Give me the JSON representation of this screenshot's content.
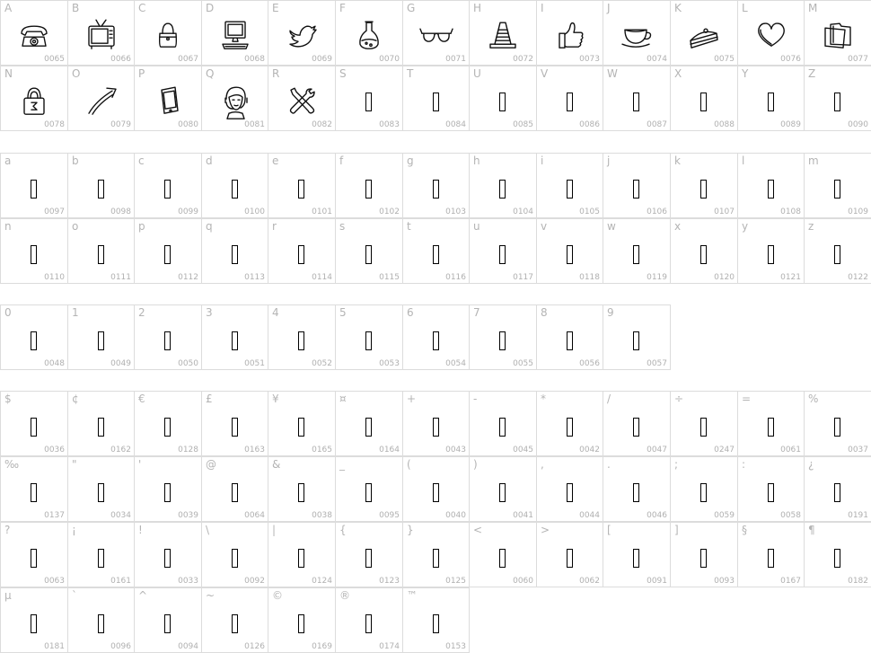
{
  "groups": [
    {
      "name": "uppercase",
      "cells": [
        {
          "label": "A",
          "code": "0065",
          "icon": "telephone-icon"
        },
        {
          "label": "B",
          "code": "0066",
          "icon": "television-icon"
        },
        {
          "label": "C",
          "code": "0067",
          "icon": "handbag-icon"
        },
        {
          "label": "D",
          "code": "0068",
          "icon": "computer-icon"
        },
        {
          "label": "E",
          "code": "0069",
          "icon": "twitter-bird-icon"
        },
        {
          "label": "F",
          "code": "0070",
          "icon": "potion-flask-icon"
        },
        {
          "label": "G",
          "code": "0071",
          "icon": "3d-glasses-icon"
        },
        {
          "label": "H",
          "code": "0072",
          "icon": "traffic-cone-icon"
        },
        {
          "label": "I",
          "code": "0073",
          "icon": "thumbs-up-icon"
        },
        {
          "label": "J",
          "code": "0074",
          "icon": "tea-cup-icon"
        },
        {
          "label": "K",
          "code": "0075",
          "icon": "cake-slice-icon"
        },
        {
          "label": "L",
          "code": "0076",
          "icon": "heart-icon"
        },
        {
          "label": "M",
          "code": "0077",
          "icon": "folders-icon"
        },
        {
          "label": "N",
          "code": "0078",
          "icon": "padlock-icon"
        },
        {
          "label": "O",
          "code": "0079",
          "icon": "arrow-icon"
        },
        {
          "label": "P",
          "code": "0080",
          "icon": "smartphone-icon"
        },
        {
          "label": "Q",
          "code": "0081",
          "icon": "headset-woman-icon"
        },
        {
          "label": "R",
          "code": "0082",
          "icon": "tools-icon"
        },
        {
          "label": "S",
          "code": "0083",
          "icon": "missing-glyph"
        },
        {
          "label": "T",
          "code": "0084",
          "icon": "missing-glyph"
        },
        {
          "label": "U",
          "code": "0085",
          "icon": "missing-glyph"
        },
        {
          "label": "V",
          "code": "0086",
          "icon": "missing-glyph"
        },
        {
          "label": "W",
          "code": "0087",
          "icon": "missing-glyph"
        },
        {
          "label": "X",
          "code": "0088",
          "icon": "missing-glyph"
        },
        {
          "label": "Y",
          "code": "0089",
          "icon": "missing-glyph"
        },
        {
          "label": "Z",
          "code": "0090",
          "icon": "missing-glyph"
        }
      ]
    },
    {
      "name": "lowercase",
      "cells": [
        {
          "label": "a",
          "code": "0097",
          "icon": "missing-glyph"
        },
        {
          "label": "b",
          "code": "0098",
          "icon": "missing-glyph"
        },
        {
          "label": "c",
          "code": "0099",
          "icon": "missing-glyph"
        },
        {
          "label": "d",
          "code": "0100",
          "icon": "missing-glyph"
        },
        {
          "label": "e",
          "code": "0101",
          "icon": "missing-glyph"
        },
        {
          "label": "f",
          "code": "0102",
          "icon": "missing-glyph"
        },
        {
          "label": "g",
          "code": "0103",
          "icon": "missing-glyph"
        },
        {
          "label": "h",
          "code": "0104",
          "icon": "missing-glyph"
        },
        {
          "label": "i",
          "code": "0105",
          "icon": "missing-glyph"
        },
        {
          "label": "j",
          "code": "0106",
          "icon": "missing-glyph"
        },
        {
          "label": "k",
          "code": "0107",
          "icon": "missing-glyph"
        },
        {
          "label": "l",
          "code": "0108",
          "icon": "missing-glyph"
        },
        {
          "label": "m",
          "code": "0109",
          "icon": "missing-glyph"
        },
        {
          "label": "n",
          "code": "0110",
          "icon": "missing-glyph"
        },
        {
          "label": "o",
          "code": "0111",
          "icon": "missing-glyph"
        },
        {
          "label": "p",
          "code": "0112",
          "icon": "missing-glyph"
        },
        {
          "label": "q",
          "code": "0113",
          "icon": "missing-glyph"
        },
        {
          "label": "r",
          "code": "0114",
          "icon": "missing-glyph"
        },
        {
          "label": "s",
          "code": "0115",
          "icon": "missing-glyph"
        },
        {
          "label": "t",
          "code": "0116",
          "icon": "missing-glyph"
        },
        {
          "label": "u",
          "code": "0117",
          "icon": "missing-glyph"
        },
        {
          "label": "v",
          "code": "0118",
          "icon": "missing-glyph"
        },
        {
          "label": "w",
          "code": "0119",
          "icon": "missing-glyph"
        },
        {
          "label": "x",
          "code": "0120",
          "icon": "missing-glyph"
        },
        {
          "label": "y",
          "code": "0121",
          "icon": "missing-glyph"
        },
        {
          "label": "z",
          "code": "0122",
          "icon": "missing-glyph"
        }
      ]
    },
    {
      "name": "digits",
      "cells": [
        {
          "label": "0",
          "code": "0048",
          "icon": "missing-glyph"
        },
        {
          "label": "1",
          "code": "0049",
          "icon": "missing-glyph"
        },
        {
          "label": "2",
          "code": "0050",
          "icon": "missing-glyph"
        },
        {
          "label": "3",
          "code": "0051",
          "icon": "missing-glyph"
        },
        {
          "label": "4",
          "code": "0052",
          "icon": "missing-glyph"
        },
        {
          "label": "5",
          "code": "0053",
          "icon": "missing-glyph"
        },
        {
          "label": "6",
          "code": "0054",
          "icon": "missing-glyph"
        },
        {
          "label": "7",
          "code": "0055",
          "icon": "missing-glyph"
        },
        {
          "label": "8",
          "code": "0056",
          "icon": "missing-glyph"
        },
        {
          "label": "9",
          "code": "0057",
          "icon": "missing-glyph"
        }
      ]
    },
    {
      "name": "symbols",
      "cells": [
        {
          "label": "$",
          "code": "0036",
          "icon": "missing-glyph"
        },
        {
          "label": "¢",
          "code": "0162",
          "icon": "missing-glyph"
        },
        {
          "label": "€",
          "code": "0128",
          "icon": "missing-glyph"
        },
        {
          "label": "£",
          "code": "0163",
          "icon": "missing-glyph"
        },
        {
          "label": "¥",
          "code": "0165",
          "icon": "missing-glyph"
        },
        {
          "label": "¤",
          "code": "0164",
          "icon": "missing-glyph"
        },
        {
          "label": "+",
          "code": "0043",
          "icon": "missing-glyph"
        },
        {
          "label": "-",
          "code": "0045",
          "icon": "missing-glyph"
        },
        {
          "label": "*",
          "code": "0042",
          "icon": "missing-glyph"
        },
        {
          "label": "/",
          "code": "0047",
          "icon": "missing-glyph"
        },
        {
          "label": "÷",
          "code": "0247",
          "icon": "missing-glyph"
        },
        {
          "label": "=",
          "code": "0061",
          "icon": "missing-glyph"
        },
        {
          "label": "%",
          "code": "0037",
          "icon": "missing-glyph"
        },
        {
          "label": "‰",
          "code": "0137",
          "icon": "missing-glyph"
        },
        {
          "label": "\"",
          "code": "0034",
          "icon": "missing-glyph"
        },
        {
          "label": "'",
          "code": "0039",
          "icon": "missing-glyph"
        },
        {
          "label": "@",
          "code": "0064",
          "icon": "missing-glyph"
        },
        {
          "label": "&",
          "code": "0038",
          "icon": "missing-glyph"
        },
        {
          "label": "_",
          "code": "0095",
          "icon": "missing-glyph"
        },
        {
          "label": "(",
          "code": "0040",
          "icon": "missing-glyph"
        },
        {
          "label": ")",
          "code": "0041",
          "icon": "missing-glyph"
        },
        {
          "label": ",",
          "code": "0044",
          "icon": "missing-glyph"
        },
        {
          "label": ".",
          "code": "0046",
          "icon": "missing-glyph"
        },
        {
          "label": ";",
          "code": "0059",
          "icon": "missing-glyph"
        },
        {
          "label": ":",
          "code": "0058",
          "icon": "missing-glyph"
        },
        {
          "label": "¿",
          "code": "0191",
          "icon": "missing-glyph"
        },
        {
          "label": "?",
          "code": "0063",
          "icon": "missing-glyph"
        },
        {
          "label": "¡",
          "code": "0161",
          "icon": "missing-glyph"
        },
        {
          "label": "!",
          "code": "0033",
          "icon": "missing-glyph"
        },
        {
          "label": "\\",
          "code": "0092",
          "icon": "missing-glyph"
        },
        {
          "label": "|",
          "code": "0124",
          "icon": "missing-glyph"
        },
        {
          "label": "{",
          "code": "0123",
          "icon": "missing-glyph"
        },
        {
          "label": "}",
          "code": "0125",
          "icon": "missing-glyph"
        },
        {
          "label": "<",
          "code": "0060",
          "icon": "missing-glyph"
        },
        {
          "label": ">",
          "code": "0062",
          "icon": "missing-glyph"
        },
        {
          "label": "[",
          "code": "0091",
          "icon": "missing-glyph"
        },
        {
          "label": "]",
          "code": "0093",
          "icon": "missing-glyph"
        },
        {
          "label": "§",
          "code": "0167",
          "icon": "missing-glyph"
        },
        {
          "label": "¶",
          "code": "0182",
          "icon": "missing-glyph"
        },
        {
          "label": "µ",
          "code": "0181",
          "icon": "missing-glyph"
        },
        {
          "label": "`",
          "code": "0096",
          "icon": "missing-glyph"
        },
        {
          "label": "^",
          "code": "0094",
          "icon": "missing-glyph"
        },
        {
          "label": "~",
          "code": "0126",
          "icon": "missing-glyph"
        },
        {
          "label": "©",
          "code": "0169",
          "icon": "missing-glyph"
        },
        {
          "label": "®",
          "code": "0174",
          "icon": "missing-glyph"
        },
        {
          "label": "™",
          "code": "0153",
          "icon": "missing-glyph"
        }
      ]
    }
  ]
}
